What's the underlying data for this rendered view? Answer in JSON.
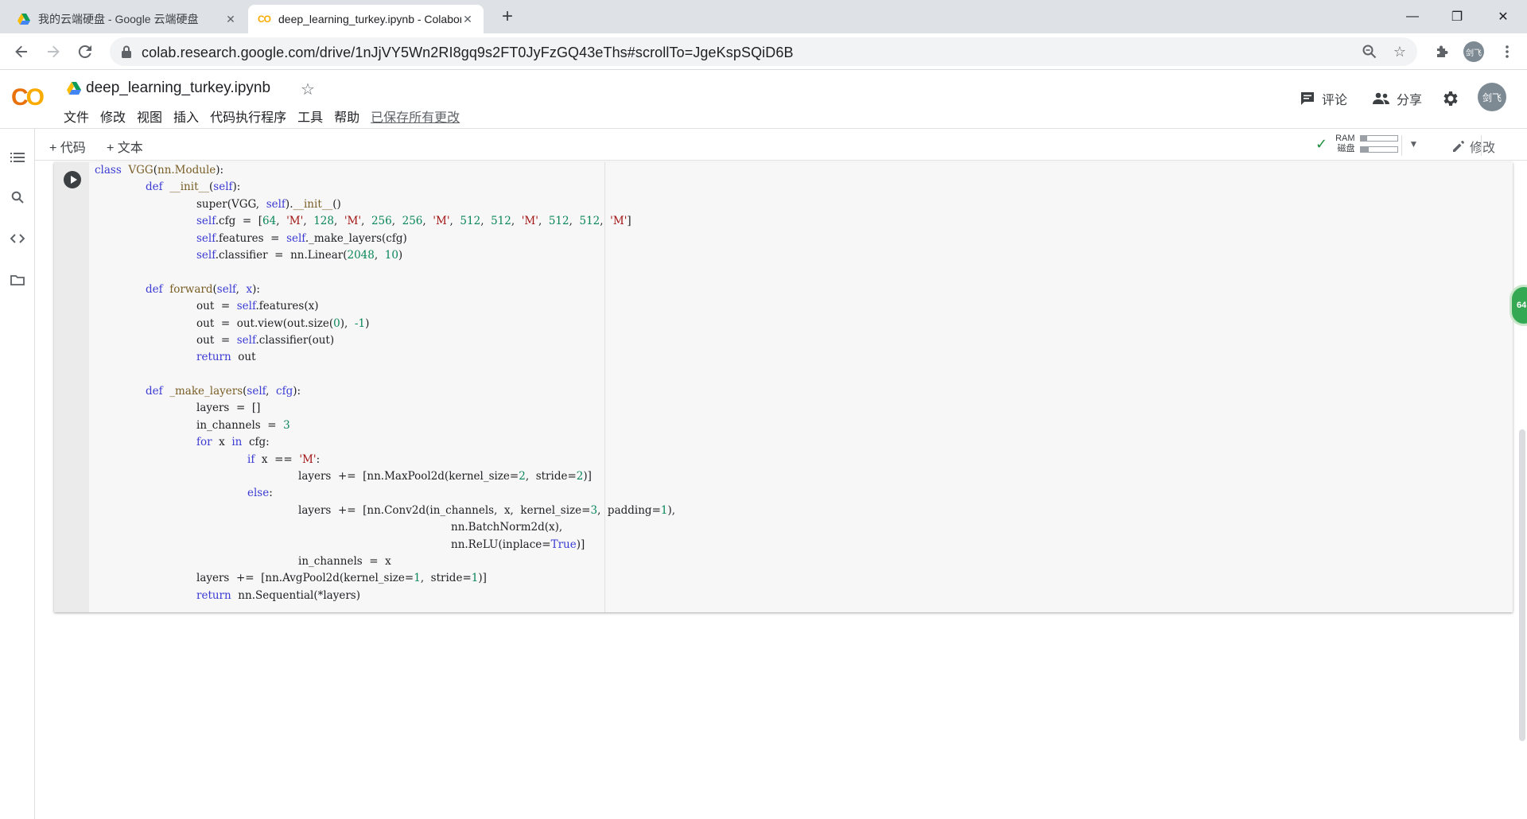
{
  "browser": {
    "tabs": [
      {
        "title": "我的云端硬盘 - Google 云端硬盘",
        "active": false
      },
      {
        "title": "deep_learning_turkey.ipynb - Colaboratory",
        "active": true
      }
    ],
    "new_tab": "+",
    "url": "colab.research.google.com/drive/1nJjVY5Wn2RI8gq9s2FT0JyFzGQ43eThs#scrollTo=JgeKspSQiD6B",
    "profile_initials": "剑飞",
    "window_controls": {
      "minimize": "—",
      "maximize": "❐",
      "close": "✕"
    }
  },
  "colab": {
    "logo": {
      "c": "C",
      "o": "O"
    },
    "notebook_title": "deep_learning_turkey.ipynb",
    "menu": [
      "文件",
      "修改",
      "视图",
      "插入",
      "代码执行程序",
      "工具",
      "帮助"
    ],
    "saved_status": "已保存所有更改",
    "comment_label": "评论",
    "share_label": "分享",
    "avatar_initials": "剑飞",
    "add_code": "+ 代码",
    "add_text": "+ 文本",
    "resources": {
      "ram_label": "RAM",
      "disk_label": "磁盘",
      "ram_usage": 0.18,
      "disk_usage": 0.22
    },
    "edit_label": "修改",
    "speed_badge": "64"
  },
  "accent_colors": {
    "keyword": "#3b3bd4",
    "number": "#098658",
    "string": "#a31515",
    "connected": "#1e8e3e"
  },
  "code_lines": [
    {
      "indent": 0,
      "tokens": [
        [
          "kw",
          "class"
        ],
        [
          "t",
          "  "
        ],
        [
          "fn",
          "VGG"
        ],
        [
          "t",
          "("
        ],
        [
          "fn",
          "nn.Module"
        ],
        [
          "t",
          "):"
        ]
      ]
    },
    {
      "indent": 1,
      "tokens": [
        [
          "kw",
          "def"
        ],
        [
          "t",
          "  "
        ],
        [
          "fn",
          "__init__"
        ],
        [
          "t",
          "("
        ],
        [
          "kw",
          "self"
        ],
        [
          "t",
          "):"
        ]
      ]
    },
    {
      "indent": 2,
      "tokens": [
        [
          "t",
          "super(VGG,  "
        ],
        [
          "kw",
          "self"
        ],
        [
          "t",
          ")."
        ],
        [
          "fn",
          "__init__"
        ],
        [
          "t",
          "()"
        ]
      ]
    },
    {
      "indent": 2,
      "tokens": [
        [
          "kw",
          "self"
        ],
        [
          "t",
          ".cfg  =  ["
        ],
        [
          "num",
          "64"
        ],
        [
          "t",
          ",  "
        ],
        [
          "str",
          "'M'"
        ],
        [
          "t",
          ",  "
        ],
        [
          "num",
          "128"
        ],
        [
          "t",
          ",  "
        ],
        [
          "str",
          "'M'"
        ],
        [
          "t",
          ",  "
        ],
        [
          "num",
          "256"
        ],
        [
          "t",
          ",  "
        ],
        [
          "num",
          "256"
        ],
        [
          "t",
          ",  "
        ],
        [
          "str",
          "'M'"
        ],
        [
          "t",
          ",  "
        ],
        [
          "num",
          "512"
        ],
        [
          "t",
          ",  "
        ],
        [
          "num",
          "512"
        ],
        [
          "t",
          ",  "
        ],
        [
          "str",
          "'M'"
        ],
        [
          "t",
          ",  "
        ],
        [
          "num",
          "512"
        ],
        [
          "t",
          ",  "
        ],
        [
          "num",
          "512"
        ],
        [
          "t",
          ",  "
        ],
        [
          "str",
          "'M'"
        ],
        [
          "t",
          "]"
        ]
      ]
    },
    {
      "indent": 2,
      "tokens": [
        [
          "kw",
          "self"
        ],
        [
          "t",
          ".features  =  "
        ],
        [
          "kw",
          "self"
        ],
        [
          "t",
          "._make_layers(cfg)"
        ]
      ]
    },
    {
      "indent": 2,
      "tokens": [
        [
          "kw",
          "self"
        ],
        [
          "t",
          ".classifier  =  nn.Linear("
        ],
        [
          "num",
          "2048"
        ],
        [
          "t",
          ",  "
        ],
        [
          "num",
          "10"
        ],
        [
          "t",
          ")"
        ]
      ]
    },
    {
      "indent": 0,
      "tokens": []
    },
    {
      "indent": 1,
      "tokens": [
        [
          "kw",
          "def"
        ],
        [
          "t",
          "  "
        ],
        [
          "fn",
          "forward"
        ],
        [
          "t",
          "("
        ],
        [
          "kw",
          "self"
        ],
        [
          "t",
          ",  "
        ],
        [
          "kw",
          "x"
        ],
        [
          "t",
          "):"
        ]
      ]
    },
    {
      "indent": 2,
      "tokens": [
        [
          "t",
          "out  =  "
        ],
        [
          "kw",
          "self"
        ],
        [
          "t",
          ".features(x)"
        ]
      ]
    },
    {
      "indent": 2,
      "tokens": [
        [
          "t",
          "out  =  out.view(out.size("
        ],
        [
          "num",
          "0"
        ],
        [
          "t",
          "),  "
        ],
        [
          "num",
          "-1"
        ],
        [
          "t",
          ")"
        ]
      ]
    },
    {
      "indent": 2,
      "tokens": [
        [
          "t",
          "out  =  "
        ],
        [
          "kw",
          "self"
        ],
        [
          "t",
          ".classifier(out)"
        ]
      ]
    },
    {
      "indent": 2,
      "tokens": [
        [
          "kw",
          "return"
        ],
        [
          "t",
          "  out"
        ]
      ]
    },
    {
      "indent": 0,
      "tokens": []
    },
    {
      "indent": 1,
      "tokens": [
        [
          "kw",
          "def"
        ],
        [
          "t",
          "  "
        ],
        [
          "fn",
          "_make_layers"
        ],
        [
          "t",
          "("
        ],
        [
          "kw",
          "self"
        ],
        [
          "t",
          ",  "
        ],
        [
          "kw",
          "cfg"
        ],
        [
          "t",
          "):"
        ]
      ]
    },
    {
      "indent": 2,
      "tokens": [
        [
          "t",
          "layers  =  []"
        ]
      ]
    },
    {
      "indent": 2,
      "tokens": [
        [
          "t",
          "in_channels  =  "
        ],
        [
          "num",
          "3"
        ]
      ]
    },
    {
      "indent": 2,
      "tokens": [
        [
          "kw",
          "for"
        ],
        [
          "t",
          "  x  "
        ],
        [
          "kw",
          "in"
        ],
        [
          "t",
          "  cfg:"
        ]
      ]
    },
    {
      "indent": 3,
      "tokens": [
        [
          "kw",
          "if"
        ],
        [
          "t",
          "  x  ==  "
        ],
        [
          "str",
          "'M'"
        ],
        [
          "t",
          ":"
        ]
      ]
    },
    {
      "indent": 4,
      "tokens": [
        [
          "t",
          "layers  +=  [nn.MaxPool2d(kernel_size="
        ],
        [
          "num",
          "2"
        ],
        [
          "t",
          ",  stride="
        ],
        [
          "num",
          "2"
        ],
        [
          "t",
          ")]"
        ]
      ]
    },
    {
      "indent": 3,
      "tokens": [
        [
          "kw",
          "else"
        ],
        [
          "t",
          ":"
        ]
      ]
    },
    {
      "indent": 4,
      "tokens": [
        [
          "t",
          "layers  +=  [nn.Conv2d(in_channels,  x,  kernel_size="
        ],
        [
          "num",
          "3"
        ],
        [
          "t",
          ",  padding="
        ],
        [
          "num",
          "1"
        ],
        [
          "t",
          "),"
        ]
      ]
    },
    {
      "indent": 7,
      "tokens": [
        [
          "t",
          "nn.BatchNorm2d(x),"
        ]
      ]
    },
    {
      "indent": 7,
      "tokens": [
        [
          "t",
          "nn.ReLU(inplace="
        ],
        [
          "kw",
          "True"
        ],
        [
          "t",
          ")]"
        ]
      ]
    },
    {
      "indent": 4,
      "tokens": [
        [
          "t",
          "in_channels  =  x"
        ]
      ]
    },
    {
      "indent": 2,
      "tokens": [
        [
          "t",
          "layers  +=  [nn.AvgPool2d(kernel_size="
        ],
        [
          "num",
          "1"
        ],
        [
          "t",
          ",  stride="
        ],
        [
          "num",
          "1"
        ],
        [
          "t",
          ")]"
        ]
      ]
    },
    {
      "indent": 2,
      "tokens": [
        [
          "kw",
          "return"
        ],
        [
          "t",
          "  nn.Sequential(*layers)"
        ]
      ]
    }
  ]
}
